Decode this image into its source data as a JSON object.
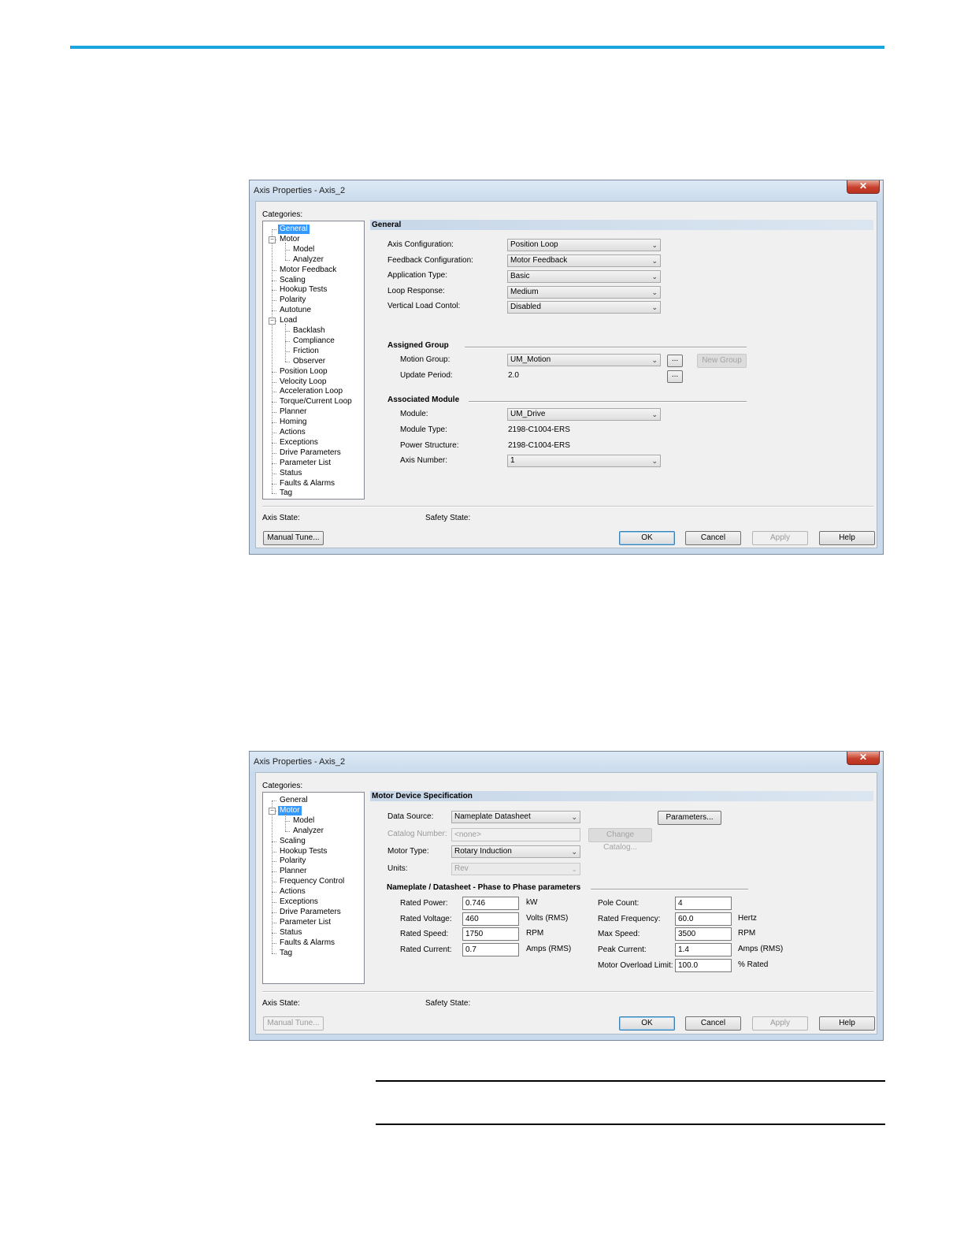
{
  "dialog1": {
    "title": "Axis Properties - Axis_2",
    "close_glyph": "✕",
    "categories_label": "Categories:",
    "tree": [
      {
        "label": "General",
        "level": 0,
        "selected": true
      },
      {
        "label": "Motor",
        "level": 0,
        "expander": true
      },
      {
        "label": "Model",
        "level": 1
      },
      {
        "label": "Analyzer",
        "level": 1
      },
      {
        "label": "Motor Feedback",
        "level": 0
      },
      {
        "label": "Scaling",
        "level": 0
      },
      {
        "label": "Hookup Tests",
        "level": 0
      },
      {
        "label": "Polarity",
        "level": 0
      },
      {
        "label": "Autotune",
        "level": 0
      },
      {
        "label": "Load",
        "level": 0,
        "expander": true
      },
      {
        "label": "Backlash",
        "level": 1
      },
      {
        "label": "Compliance",
        "level": 1
      },
      {
        "label": "Friction",
        "level": 1
      },
      {
        "label": "Observer",
        "level": 1
      },
      {
        "label": "Position Loop",
        "level": 0
      },
      {
        "label": "Velocity Loop",
        "level": 0
      },
      {
        "label": "Acceleration Loop",
        "level": 0
      },
      {
        "label": "Torque/Current Loop",
        "level": 0
      },
      {
        "label": "Planner",
        "level": 0
      },
      {
        "label": "Homing",
        "level": 0
      },
      {
        "label": "Actions",
        "level": 0
      },
      {
        "label": "Exceptions",
        "level": 0
      },
      {
        "label": "Drive Parameters",
        "level": 0
      },
      {
        "label": "Parameter List",
        "level": 0
      },
      {
        "label": "Status",
        "level": 0
      },
      {
        "label": "Faults & Alarms",
        "level": 0
      },
      {
        "label": "Tag",
        "level": 0
      }
    ],
    "section_title": "General",
    "axis_configuration": {
      "label": "Axis Configuration:",
      "value": "Position Loop"
    },
    "feedback_configuration": {
      "label": "Feedback Configuration:",
      "value": "Motor Feedback"
    },
    "application_type": {
      "label": "Application Type:",
      "value": "Basic"
    },
    "loop_response": {
      "label": "Loop Response:",
      "value": "Medium"
    },
    "vertical_load": {
      "label": "Vertical Load Contol:",
      "value": "Disabled"
    },
    "assigned_group": {
      "heading": "Assigned Group",
      "motion_group_label": "Motion Group:",
      "motion_group_value": "UM_Motion",
      "ellipsis": "...",
      "new_group": "New Group",
      "update_period_label": "Update Period:",
      "update_period_value": "2.0"
    },
    "associated_module": {
      "heading": "Associated Module",
      "module_label": "Module:",
      "module_value": "UM_Drive",
      "module_type_label": "Module Type:",
      "module_type_value": "2198-C1004-ERS",
      "power_structure_label": "Power Structure:",
      "power_structure_value": "2198-C1004-ERS",
      "axis_number_label": "Axis Number:",
      "axis_number_value": "1"
    },
    "axis_state_label": "Axis State:",
    "safety_state_label": "Safety State:",
    "buttons": {
      "manual_tune": "Manual Tune...",
      "ok": "OK",
      "cancel": "Cancel",
      "apply": "Apply",
      "help": "Help"
    }
  },
  "dialog2": {
    "title": "Axis Properties - Axis_2",
    "close_glyph": "✕",
    "categories_label": "Categories:",
    "tree": [
      {
        "label": "General",
        "level": 0
      },
      {
        "label": "Motor",
        "level": 0,
        "expander": true,
        "selected": true
      },
      {
        "label": "Model",
        "level": 1
      },
      {
        "label": "Analyzer",
        "level": 1
      },
      {
        "label": "Scaling",
        "level": 0
      },
      {
        "label": "Hookup Tests",
        "level": 0
      },
      {
        "label": "Polarity",
        "level": 0
      },
      {
        "label": "Planner",
        "level": 0
      },
      {
        "label": "Frequency Control",
        "level": 0
      },
      {
        "label": "Actions",
        "level": 0
      },
      {
        "label": "Exceptions",
        "level": 0
      },
      {
        "label": "Drive Parameters",
        "level": 0
      },
      {
        "label": "Parameter List",
        "level": 0
      },
      {
        "label": "Status",
        "level": 0
      },
      {
        "label": "Faults & Alarms",
        "level": 0
      },
      {
        "label": "Tag",
        "level": 0
      }
    ],
    "section_title": "Motor Device Specification",
    "data_source": {
      "label": "Data Source:",
      "value": "Nameplate Datasheet"
    },
    "parameters_button": "Parameters...",
    "catalog_number": {
      "label": "Catalog Number:",
      "value": "<none>"
    },
    "change_catalog_button": "Change Catalog...",
    "motor_type": {
      "label": "Motor Type:",
      "value": "Rotary Induction"
    },
    "units": {
      "label": "Units:",
      "value": "Rev"
    },
    "nameplate_heading": "Nameplate / Datasheet - Phase to Phase parameters",
    "left_params": [
      {
        "label": "Rated Power:",
        "value": "0.746",
        "unit": "kW"
      },
      {
        "label": "Rated Voltage:",
        "value": "460",
        "unit": "Volts (RMS)"
      },
      {
        "label": "Rated Speed:",
        "value": "1750",
        "unit": "RPM"
      },
      {
        "label": "Rated Current:",
        "value": "0.7",
        "unit": "Amps (RMS)"
      }
    ],
    "right_params": [
      {
        "label": "Pole Count:",
        "value": "4",
        "unit": ""
      },
      {
        "label": "Rated Frequency:",
        "value": "60.0",
        "unit": "Hertz"
      },
      {
        "label": "Max Speed:",
        "value": "3500",
        "unit": "RPM"
      },
      {
        "label": "Peak Current:",
        "value": "1.4",
        "unit": "Amps (RMS)"
      },
      {
        "label": "Motor Overload Limit:",
        "value": "100.0",
        "unit": "% Rated"
      }
    ],
    "axis_state_label": "Axis State:",
    "safety_state_label": "Safety State:",
    "buttons": {
      "manual_tune": "Manual Tune...",
      "ok": "OK",
      "cancel": "Cancel",
      "apply": "Apply",
      "help": "Help"
    }
  }
}
